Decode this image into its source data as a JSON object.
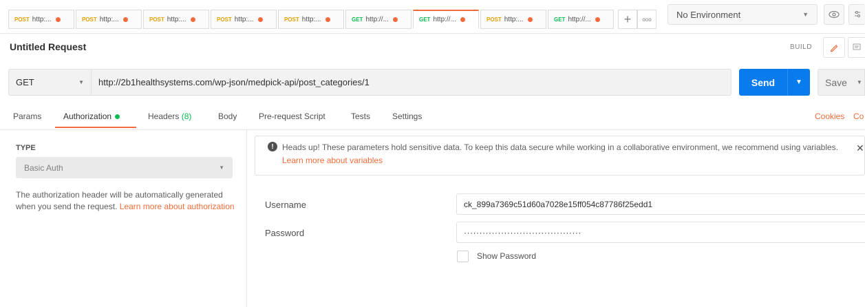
{
  "tabs": [
    {
      "method": "POST",
      "url": "http:..."
    },
    {
      "method": "POST",
      "url": "http:..."
    },
    {
      "method": "POST",
      "url": "http:..."
    },
    {
      "method": "POST",
      "url": "http:..."
    },
    {
      "method": "POST",
      "url": "http:..."
    },
    {
      "method": "GET",
      "url": "http://..."
    },
    {
      "method": "GET",
      "url": "http://..."
    },
    {
      "method": "POST",
      "url": "http:..."
    },
    {
      "method": "GET",
      "url": "http://..."
    }
  ],
  "tab_actions": {
    "add": "+",
    "more": "ooo"
  },
  "environment": {
    "selected": "No Environment"
  },
  "request": {
    "name": "Untitled Request",
    "build_label": "BUILD",
    "method": "GET",
    "url": "http://2b1healthsystems.com/wp-json/medpick-api/post_categories/1",
    "send_label": "Send",
    "save_label": "Save"
  },
  "subtabs": {
    "params": "Params",
    "authorization": "Authorization",
    "headers": "Headers",
    "headers_count": "(8)",
    "body": "Body",
    "prerequest": "Pre-request Script",
    "tests": "Tests",
    "settings": "Settings",
    "cookies": "Cookies",
    "code": "Co"
  },
  "auth": {
    "type_label": "TYPE",
    "type_value": "Basic Auth",
    "description": "The authorization header will be automatically generated when you send the request.",
    "learn_more": "Learn more about authorization",
    "alert_text": "Heads up! These parameters hold sensitive data. To keep this data secure while working in a collaborative environment, we recommend using variables.",
    "alert_link": "Learn more about variables",
    "username_label": "Username",
    "username_value": "ck_899a7369c51d60a7028e15ff054c87786f25edd1",
    "password_label": "Password",
    "password_value": "······································",
    "show_password_label": "Show Password"
  },
  "colors": {
    "accent": "#f26b3a",
    "send": "#097bed",
    "post": "#e5a100",
    "get": "#0cbb52"
  },
  "icons": {
    "env_chevron": "chevron-down-icon",
    "eye": "eye-icon",
    "settings": "sliders-icon",
    "edit": "pencil-icon",
    "comment": "comment-icon",
    "info": "info-icon",
    "close": "close-icon"
  }
}
